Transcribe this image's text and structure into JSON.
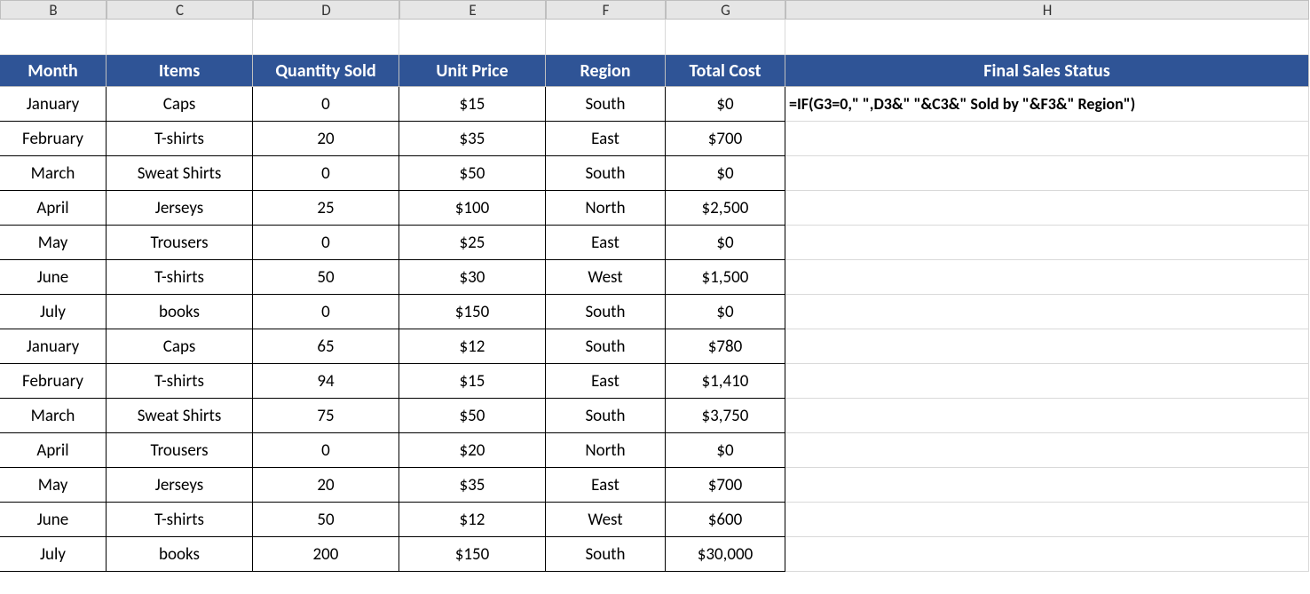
{
  "columns": [
    "B",
    "C",
    "D",
    "E",
    "F",
    "G",
    "H"
  ],
  "headers": {
    "month": "Month",
    "items": "Items",
    "quantity": "Quantity Sold",
    "unit_price": "Unit Price",
    "region": "Region",
    "total_cost": "Total Cost",
    "status": "Final Sales Status"
  },
  "formula": "=IF(G3=0,\" \",D3&\" \"&C3&\" Sold by \"&F3&\" Region\")",
  "rows": [
    {
      "month": "January",
      "items": "Caps",
      "qty": "0",
      "price": "$15",
      "region": "South",
      "total": "$0",
      "status_formula": true
    },
    {
      "month": "February",
      "items": "T-shirts",
      "qty": "20",
      "price": "$35",
      "region": "East",
      "total": "$700"
    },
    {
      "month": "March",
      "items": "Sweat Shirts",
      "qty": "0",
      "price": "$50",
      "region": "South",
      "total": "$0"
    },
    {
      "month": "April",
      "items": "Jerseys",
      "qty": "25",
      "price": "$100",
      "region": "North",
      "total": "$2,500"
    },
    {
      "month": "May",
      "items": "Trousers",
      "qty": "0",
      "price": "$25",
      "region": "East",
      "total": "$0"
    },
    {
      "month": "June",
      "items": "T-shirts",
      "qty": "50",
      "price": "$30",
      "region": "West",
      "total": "$1,500"
    },
    {
      "month": "July",
      "items": "books",
      "qty": "0",
      "price": "$150",
      "region": "South",
      "total": "$0"
    },
    {
      "month": "January",
      "items": "Caps",
      "qty": "65",
      "price": "$12",
      "region": "South",
      "total": "$780"
    },
    {
      "month": "February",
      "items": "T-shirts",
      "qty": "94",
      "price": "$15",
      "region": "East",
      "total": "$1,410"
    },
    {
      "month": "March",
      "items": "Sweat Shirts",
      "qty": "75",
      "price": "$50",
      "region": "South",
      "total": "$3,750"
    },
    {
      "month": "April",
      "items": "Trousers",
      "qty": "0",
      "price": "$20",
      "region": "North",
      "total": "$0"
    },
    {
      "month": "May",
      "items": "Jerseys",
      "qty": "20",
      "price": "$35",
      "region": "East",
      "total": "$700"
    },
    {
      "month": "June",
      "items": "T-shirts",
      "qty": "50",
      "price": "$12",
      "region": "West",
      "total": "$600"
    },
    {
      "month": "July",
      "items": "books",
      "qty": "200",
      "price": "$150",
      "region": "South",
      "total": "$30,000"
    }
  ]
}
